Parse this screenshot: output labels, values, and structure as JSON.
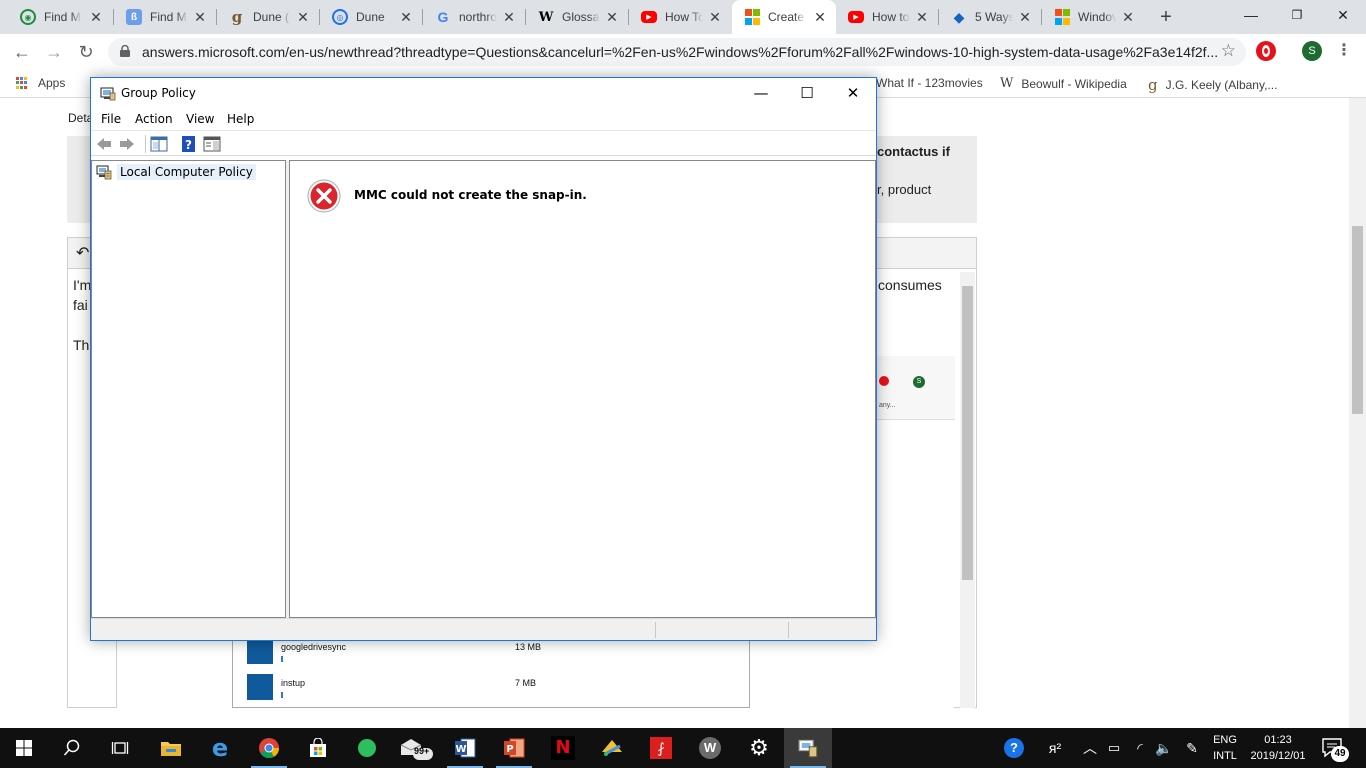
{
  "browser": {
    "tabs": [
      {
        "title": "Find M",
        "icon": "green-circle-icon",
        "color": "#1e8e3e"
      },
      {
        "title": "Find M",
        "icon": "bluebird-icon",
        "color": "#4a90e2"
      },
      {
        "title": "Dune (",
        "icon": "goodreads-g-icon",
        "color": "#7a5a2f"
      },
      {
        "title": "Dune",
        "icon": "dune-globe-icon",
        "color": "#1a73e8"
      },
      {
        "title": "northro",
        "icon": "google-icon",
        "color": "#4285f4"
      },
      {
        "title": "Glossar",
        "icon": "wikipedia-icon",
        "color": "#000000"
      },
      {
        "title": "How To",
        "icon": "youtube-icon",
        "color": "#ff0000"
      },
      {
        "title": "Create",
        "icon": "microsoft-icon",
        "color": "#f25022",
        "active": true
      },
      {
        "title": "How to",
        "icon": "youtube-icon",
        "color": "#ff0000"
      },
      {
        "title": "5 Ways",
        "icon": "diamond-icon",
        "color": "#1565c0"
      },
      {
        "title": "Windov",
        "icon": "microsoft-icon",
        "color": "#f25022"
      }
    ],
    "new_tab_label": "+",
    "url": "answers.microsoft.com/en-us/newthread?threadtype=Questions&cancelurl=%2Fen-us%2Fwindows%2Fforum%2Fall%2Fwindows-10-high-system-data-usage%2Fa3e14f2f...",
    "profile_initial": "S",
    "bookmarks": [
      {
        "label": "Apps"
      },
      {
        "label": "What If - 123movies"
      },
      {
        "label": "Beowulf - Wikipedia",
        "prefix": "W"
      },
      {
        "label": "J.G. Keely (Albany,...",
        "prefix": "g"
      }
    ]
  },
  "page": {
    "details_fragment": "Deta",
    "notice_fragment_1": "contactus if",
    "notice_fragment_2": "r, product",
    "body_fragment_1": "I'm",
    "body_fragment_2": "fai",
    "body_fragment_3": "Th",
    "body_fragment_4": "consumes",
    "embed_profile_initial": "S",
    "embed_bookmark_fragment": "any...",
    "task_manager_rows": [
      {
        "name": "googledrivesync",
        "size": "13 MB"
      },
      {
        "name": "instup",
        "size": "7 MB"
      }
    ]
  },
  "gp_window": {
    "title": "Group Policy",
    "menu": [
      "File",
      "Action",
      "View",
      "Help"
    ],
    "tree_item": "Local Computer Policy",
    "error_message": "MMC could not create the snap-in.",
    "minimize_glyph": "—",
    "maximize_glyph": "☐",
    "close_glyph": "✕"
  },
  "taskbar": {
    "language_line1": "ENG",
    "language_line2": "INTL",
    "time": "01:23",
    "date": "2019/12/01",
    "mail_badge": "99+",
    "notification_count": "49"
  },
  "colors": {
    "accent": "#1b78d4",
    "error_red": "#d9262c",
    "taskbar": "#101010"
  }
}
